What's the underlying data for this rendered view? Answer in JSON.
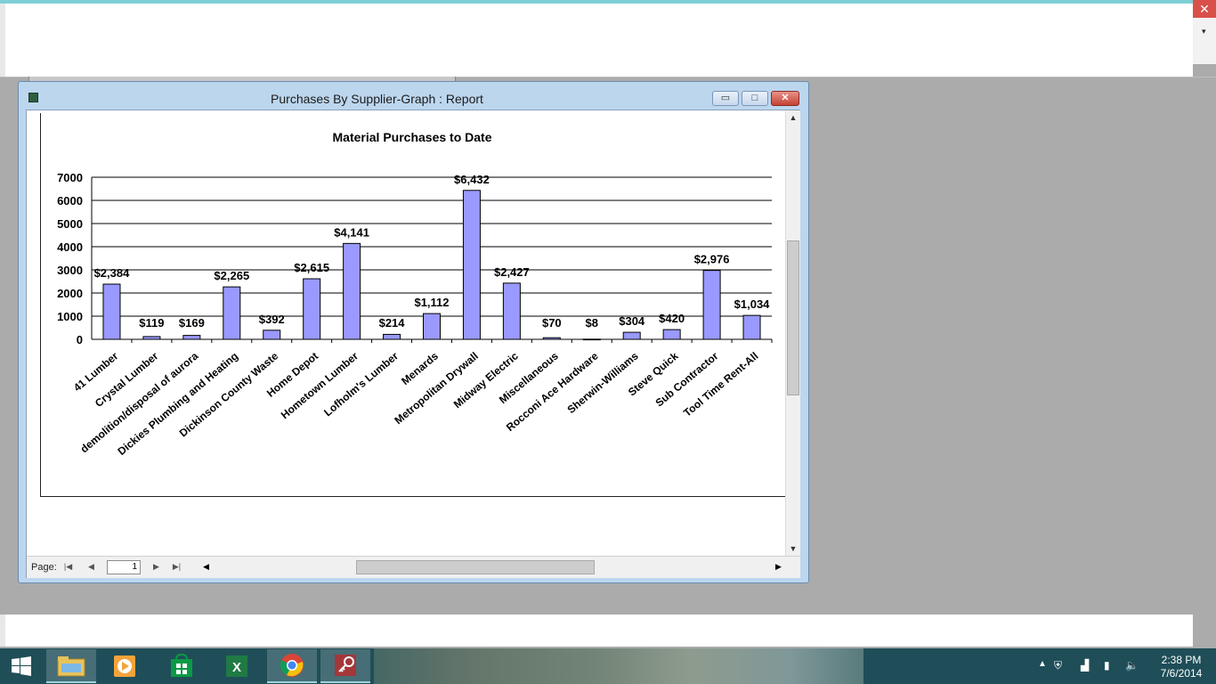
{
  "window": {
    "title": "Purchases By Supplier-Graph : Report",
    "minimize": "▭",
    "maximize": "□",
    "close": "✕"
  },
  "app": {
    "close": "✕",
    "dropdown_arrow": "▾"
  },
  "navigation": {
    "page_label": "Page:",
    "page_value": "1",
    "first_icon": "first-page-icon",
    "prev_icon": "prev-page-icon",
    "next_icon": "next-page-icon",
    "last_icon": "last-page-icon"
  },
  "chart_data": {
    "type": "bar",
    "title": "Material Purchases to Date",
    "xlabel": "",
    "ylabel": "",
    "ylim": [
      0,
      7000
    ],
    "yticks": [
      "0",
      "1000",
      "2000",
      "3000",
      "4000",
      "5000",
      "6000",
      "7000"
    ],
    "grid": true,
    "bar_color": "#9999ff",
    "categories": [
      "41 Lumber",
      "Crystal Lumber",
      "demolition/disposal of aurora",
      "Dickies Plumbing and Heating",
      "Dickinson County Waste",
      "Home Depot",
      "Hometown Lumber",
      "Lofholm's Lumber",
      "Menards",
      "Metropolitan Drywall",
      "Midway Electric",
      "Miscellaneous",
      "Rocconi Ace Hardware",
      "Sherwin-Williams",
      "Steve Quick",
      "Sub Contractor",
      "Tool Time Rent-All"
    ],
    "values": [
      2384,
      119,
      169,
      2265,
      392,
      2615,
      4141,
      214,
      1112,
      6432,
      2427,
      70,
      8,
      304,
      420,
      2976,
      1034
    ],
    "data_labels": [
      "$2,384",
      "$119",
      "$169",
      "$2,265",
      "$392",
      "$2,615",
      "$4,141",
      "$214",
      "$1,112",
      "$6,432",
      "$2,427",
      "$70",
      "$8",
      "$304",
      "$420",
      "$2,976",
      "$1,034"
    ]
  },
  "taskbar": {
    "items": [
      "start-icon",
      "file-explorer-icon",
      "media-player-icon",
      "store-icon",
      "excel-icon",
      "chrome-icon",
      "access-icon"
    ],
    "time": "2:38 PM",
    "date": "7/6/2014"
  }
}
